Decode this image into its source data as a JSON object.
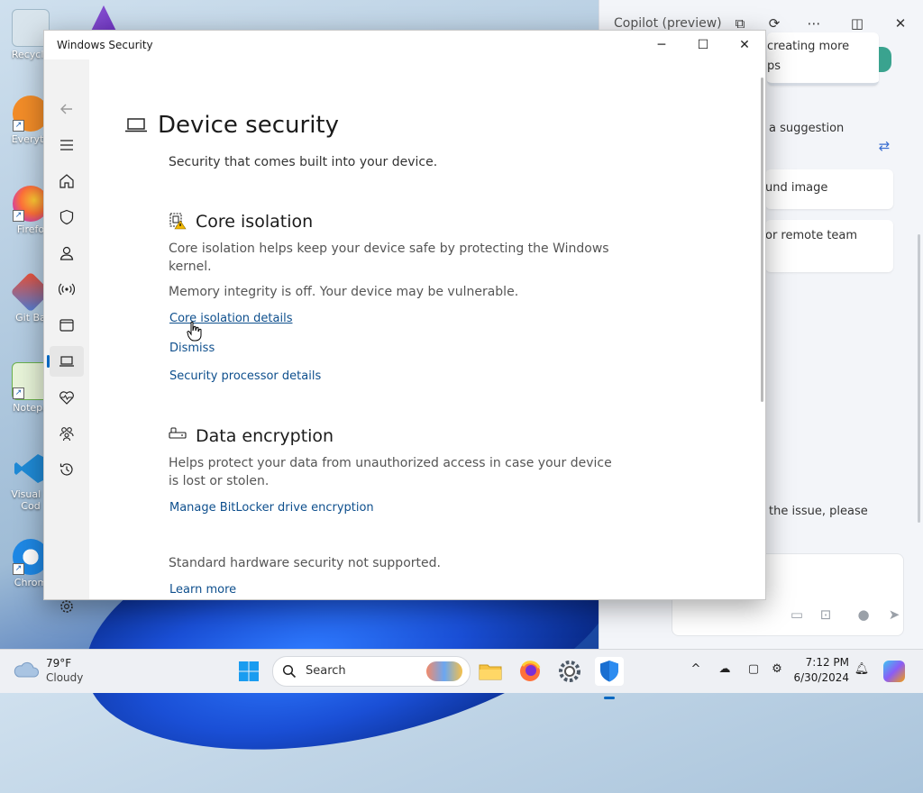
{
  "desktop": {
    "icons": [
      {
        "label": "Recycle",
        "color": "#9fb8c8"
      },
      {
        "label": "Everyth",
        "color": "#f28c28"
      },
      {
        "label": "Firefo",
        "color": "#ff7139"
      },
      {
        "label": "Git Ba",
        "color": "#f05033"
      },
      {
        "label": "Notepa",
        "color": "#6ab04c"
      },
      {
        "label": "Visual S Cod",
        "color": "#1f8ad6"
      },
      {
        "label": "Chrom",
        "color": "#1e88e5"
      }
    ]
  },
  "copilot": {
    "title": "Copilot (preview)",
    "snippets": {
      "top1": "creating more",
      "top2": "ps",
      "suggestion_label": "a suggestion",
      "card1": "und image",
      "card2": "or remote team",
      "issue1": "the issue, please"
    }
  },
  "window": {
    "title": "Windows Security",
    "page_title": "Device security",
    "page_subtitle": "Security that comes built into your device.",
    "sections": {
      "core_isolation": {
        "title": "Core isolation",
        "description": "Core isolation helps keep your device safe by protecting the Windows kernel.",
        "status": "Memory integrity is off. Your device may be vulnerable.",
        "link_details": "Core isolation details",
        "link_dismiss": "Dismiss",
        "link_processor": "Security processor details"
      },
      "data_encryption": {
        "title": "Data encryption",
        "description": "Helps protect your data from unauthorized access in case your device is lost or stolen.",
        "link_bitlocker": "Manage BitLocker drive encryption"
      },
      "hardware": {
        "status": "Standard hardware security not supported.",
        "link_learn": "Learn more"
      }
    },
    "nav": [
      {
        "name": "back-icon"
      },
      {
        "name": "menu-icon"
      },
      {
        "name": "home-icon"
      },
      {
        "name": "shield-icon"
      },
      {
        "name": "person-icon"
      },
      {
        "name": "wifi-icon"
      },
      {
        "name": "app-browser-icon"
      },
      {
        "name": "laptop-icon",
        "active": true
      },
      {
        "name": "heart-pulse-icon"
      },
      {
        "name": "family-icon"
      },
      {
        "name": "history-icon"
      },
      {
        "name": "settings-icon"
      }
    ],
    "accent": "#0067c0",
    "link_color": "#0e4f8d"
  },
  "taskbar": {
    "weather_temp": "79°F",
    "weather_cond": "Cloudy",
    "search_label": "Search",
    "clock_time": "7:12 PM",
    "clock_date": "6/30/2024",
    "pinned": [
      "windows-start-icon",
      "file-explorer-icon",
      "firefox-icon",
      "settings-icon",
      "windows-security-icon"
    ]
  }
}
